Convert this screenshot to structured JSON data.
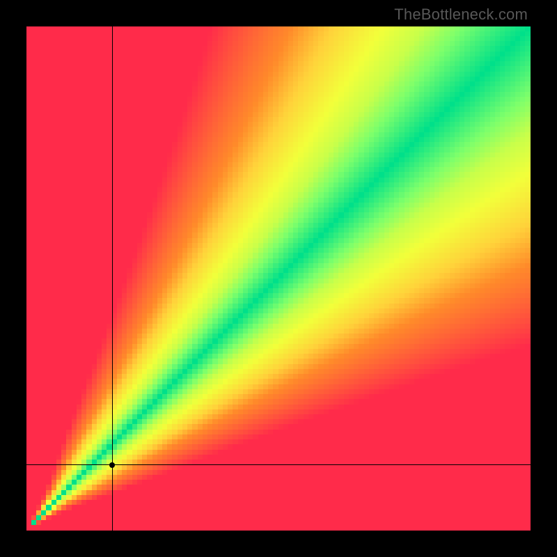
{
  "watermark": "TheBottleneck.com",
  "chart_data": {
    "type": "heatmap",
    "title": "",
    "xlabel": "",
    "ylabel": "",
    "xlim": [
      0,
      100
    ],
    "ylim": [
      0,
      100
    ],
    "notes": "Heatmap over a 100×100 grid. Color encodes bottleneck balance: green = balanced (ratio ~1 along the diagonal band), yellow = mild imbalance, red = severe imbalance. Computed as value = 1 - min(1, |log(effY / effX)| * k) with a slight nonlinearity near the origin giving a soft kink in the green band at low values. Black crosshair marks a selected (x, y) point.",
    "grid_size": 100,
    "color_stops": [
      {
        "t": 0.0,
        "hex": "#ff2b4a"
      },
      {
        "t": 0.2,
        "hex": "#ff5a3a"
      },
      {
        "t": 0.4,
        "hex": "#ff8a2a"
      },
      {
        "t": 0.55,
        "hex": "#ffd23a"
      },
      {
        "t": 0.7,
        "hex": "#f2ff3a"
      },
      {
        "t": 0.8,
        "hex": "#c8ff4a"
      },
      {
        "t": 0.88,
        "hex": "#7dff6b"
      },
      {
        "t": 1.0,
        "hex": "#00e08a"
      }
    ],
    "crosshair": {
      "x": 17,
      "y": 13
    },
    "marker_radius_px": 4,
    "band_params": {
      "k": 1.35,
      "origin_kink_strength": 3.0,
      "origin_kink_range": 10
    }
  }
}
